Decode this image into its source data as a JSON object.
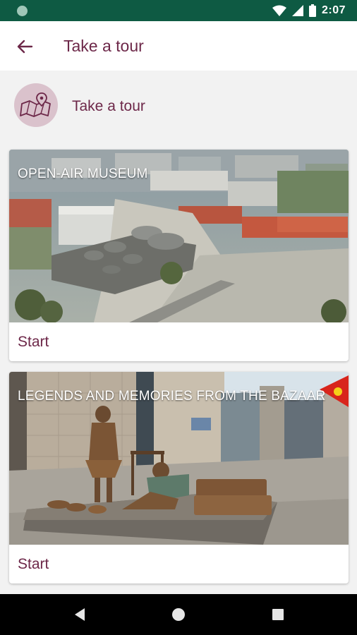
{
  "status_bar": {
    "time": "2:07",
    "icons": [
      "notification-dot-icon",
      "wifi-icon",
      "signal-icon",
      "battery-icon"
    ]
  },
  "app_bar": {
    "title": "Take a tour",
    "back_icon": "arrow-back-icon"
  },
  "header": {
    "icon": "map-pin-icon",
    "label": "Take a tour"
  },
  "tours": [
    {
      "title": "OPEN-AIR MUSEUM",
      "action": "Start",
      "image": "aerial city view with domed bazaar"
    },
    {
      "title": "LEGENDS AND MEMORIES FROM THE BAZAAR",
      "action": "Start",
      "image": "bronze statues of children on plaza"
    }
  ],
  "nav_bar": {
    "icons": [
      "back-triangle-icon",
      "home-circle-icon",
      "recents-square-icon"
    ]
  },
  "colors": {
    "status_bar": "#0e5a43",
    "accent": "#6d2849",
    "avatar_bg": "#dac2cc",
    "background": "#f2f2f2"
  }
}
